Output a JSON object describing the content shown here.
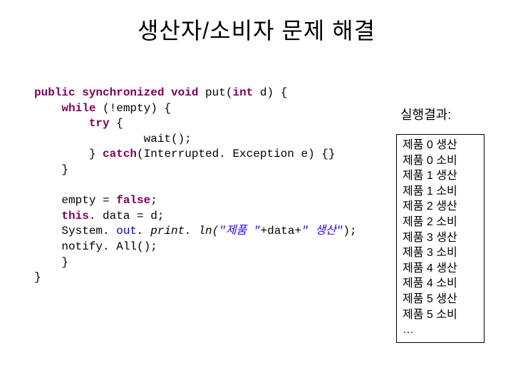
{
  "title": "생산자/소비자 문제 해결",
  "code": {
    "l1a": "public",
    "l1b": "synchronized",
    "l1c": "void",
    "l1d": " put(",
    "l1e": "int",
    "l1f": " d) {",
    "l2a": "while",
    "l2b": " (!empty) {",
    "l3a": "try",
    "l3b": " {",
    "l4": "wait();",
    "l5a": "} ",
    "l5b": "catch",
    "l5c": "(Interrupted. Exception e) {}",
    "l6": "}",
    "l8a": "empty = ",
    "l8b": "false",
    "l8c": ";",
    "l9a": "this",
    "l9b": ". data = d;",
    "l10a": "System. ",
    "l10b": "out",
    "l10c": ". print. ln(",
    "l10d": "\"제품 \"",
    "l10e": "+data+",
    "l10f": "\" 생산\"",
    "l10g": ");",
    "l11": "notify. All();",
    "l12": "}",
    "l13": "}"
  },
  "result_label": "실행결과:",
  "results": [
    "제품 0 생산",
    "제품 0 소비",
    "제품 1 생산",
    "제품 1 소비",
    "제품 2 생산",
    "제품 2 소비",
    "제품 3 생산",
    "제품 3 소비",
    "제품 4 생산",
    "제품 4 소비",
    "제품 5 생산",
    "제품 5 소비",
    "…"
  ]
}
